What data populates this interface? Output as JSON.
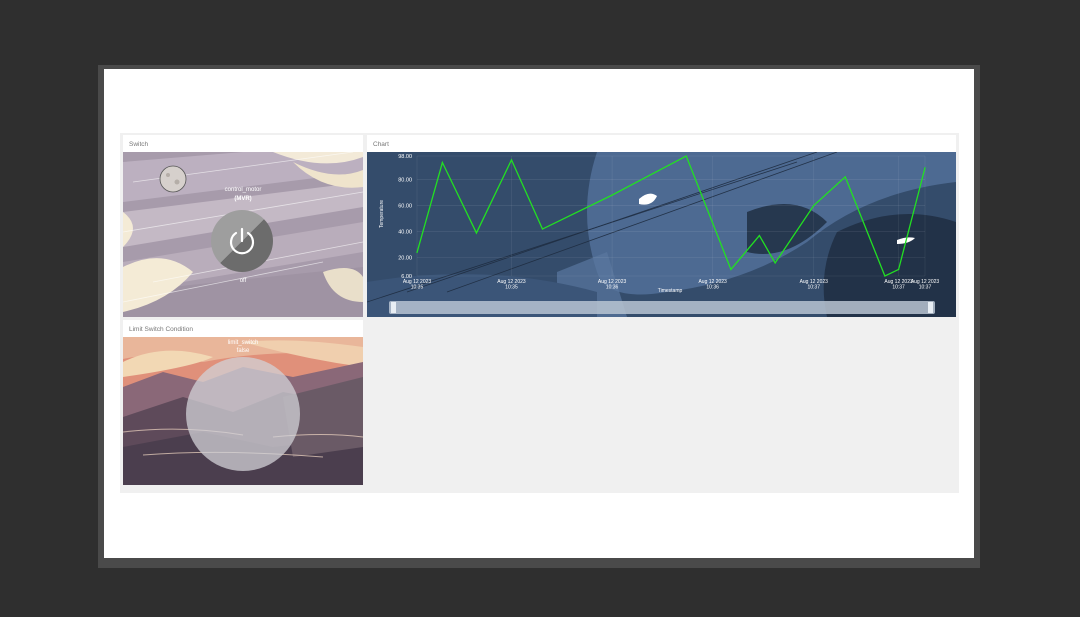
{
  "switch_widget": {
    "title": "Switch",
    "device_name": "control_motor",
    "device_code": "(MVR)",
    "state": "off",
    "icon": "power-icon"
  },
  "limit_widget": {
    "title": "Limit Switch Condition",
    "device_name": "limit_switch",
    "state": "false"
  },
  "chart_widget": {
    "title": "Chart"
  },
  "chart_data": {
    "type": "line",
    "ylabel": "Temperature",
    "xlabel": "Timestamp",
    "y_ticks": [
      "98.00",
      "80.00",
      "60.00",
      "40.00",
      "20.00",
      "6.00"
    ],
    "ylim": [
      6,
      98
    ],
    "x_ticks": [
      [
        "Aug 12 2023",
        "10:35"
      ],
      [
        "Aug 12 2023",
        "10:35"
      ],
      [
        "Aug 12 2023",
        "10:36"
      ],
      [
        "Aug 12 2023",
        "10:36"
      ],
      [
        "Aug 12 2023",
        "10:37"
      ],
      [
        "Aug 12 2023",
        "10:37"
      ],
      [
        "Aug 12 2023",
        "10:37"
      ]
    ],
    "x_tick_positions": [
      0,
      0.186,
      0.384,
      0.582,
      0.781,
      0.948,
      1.0
    ],
    "series": [
      {
        "color": "#22e022",
        "x": [
          0,
          0.05,
          0.117,
          0.186,
          0.247,
          0.384,
          0.53,
          0.618,
          0.674,
          0.705,
          0.781,
          0.843,
          0.921,
          0.948,
          1.0
        ],
        "values": [
          24,
          93,
          39,
          95,
          42,
          68,
          98,
          11,
          37,
          16,
          60,
          82,
          6,
          11,
          89
        ]
      }
    ],
    "grid": true,
    "scrollbar": true
  }
}
